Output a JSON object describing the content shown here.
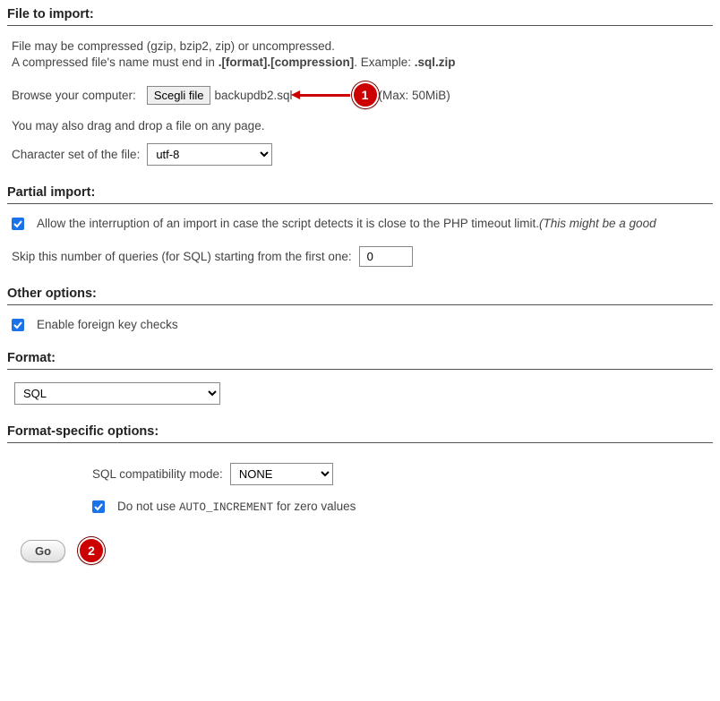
{
  "sections": {
    "file_to_import": "File to import:",
    "partial_import": "Partial import:",
    "other_options": "Other options:",
    "format": "Format:",
    "format_specific": "Format-specific options:"
  },
  "file": {
    "compressed_note_1": "File may be compressed (gzip, bzip2, zip) or uncompressed.",
    "compressed_note_2a": "A compressed file's name must end in ",
    "compressed_note_2b": ".[format].[compression]",
    "compressed_note_2c": ". Example: ",
    "compressed_note_2d": ".sql.zip",
    "browse_label": "Browse your computer:",
    "choose_button": "Scegli file",
    "chosen_filename": "backupdb2.sql",
    "max_size": "(Max: 50MiB)",
    "dragdrop_note": "You may also drag and drop a file on any page.",
    "charset_label": "Character set of the file:",
    "charset_value": "utf-8"
  },
  "partial": {
    "allow_interrupt_a": "Allow the interruption of an import in case the script detects it is close to the PHP timeout limit. ",
    "allow_interrupt_b": "(This might be a good",
    "skip_label": "Skip this number of queries (for SQL) starting from the first one:",
    "skip_value": "0"
  },
  "other": {
    "fk_label": "Enable foreign key checks"
  },
  "format_opts": {
    "value": "SQL"
  },
  "fs_opts": {
    "compat_label": "SQL compatibility mode:",
    "compat_value": "NONE",
    "autoinc_a": "Do not use ",
    "autoinc_b": "AUTO_INCREMENT",
    "autoinc_c": " for zero values"
  },
  "go_button": "Go",
  "annotations": {
    "one": "1",
    "two": "2"
  }
}
